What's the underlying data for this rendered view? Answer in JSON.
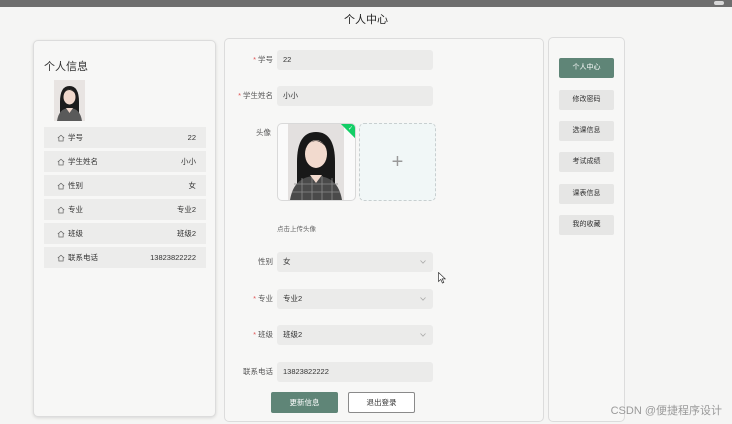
{
  "page": {
    "title": "个人中心"
  },
  "left": {
    "title": "个人信息",
    "rows": [
      {
        "label": "学号",
        "value": "22"
      },
      {
        "label": "学生姓名",
        "value": "小小"
      },
      {
        "label": "性别",
        "value": "女"
      },
      {
        "label": "专业",
        "value": "专业2"
      },
      {
        "label": "班级",
        "value": "班级2"
      },
      {
        "label": "联系电话",
        "value": "13823822222"
      }
    ]
  },
  "form": {
    "student_id": {
      "label": "学号",
      "value": "22",
      "required": true
    },
    "name": {
      "label": "学生姓名",
      "value": "小小",
      "required": true
    },
    "avatar": {
      "label": "头像",
      "plus": "+",
      "hint": "点击上传头像"
    },
    "gender": {
      "label": "性别",
      "value": "女"
    },
    "major": {
      "label": "专业",
      "value": "专业2",
      "required": true
    },
    "class": {
      "label": "班级",
      "value": "班级2",
      "required": true
    },
    "phone": {
      "label": "联系电话",
      "value": "13823822222"
    },
    "update_label": "更新信息",
    "logout_label": "退出登录"
  },
  "menu": {
    "items": [
      {
        "label": "个人中心",
        "active": true
      },
      {
        "label": "修改密码",
        "active": false
      },
      {
        "label": "选课信息",
        "active": false
      },
      {
        "label": "考试成绩",
        "active": false
      },
      {
        "label": "课表信息",
        "active": false
      },
      {
        "label": "我的收藏",
        "active": false
      }
    ]
  },
  "watermark": "CSDN @便捷程序设计",
  "colors": {
    "accent": "#5f8577",
    "required": "#e05656",
    "success": "#13ce66"
  }
}
